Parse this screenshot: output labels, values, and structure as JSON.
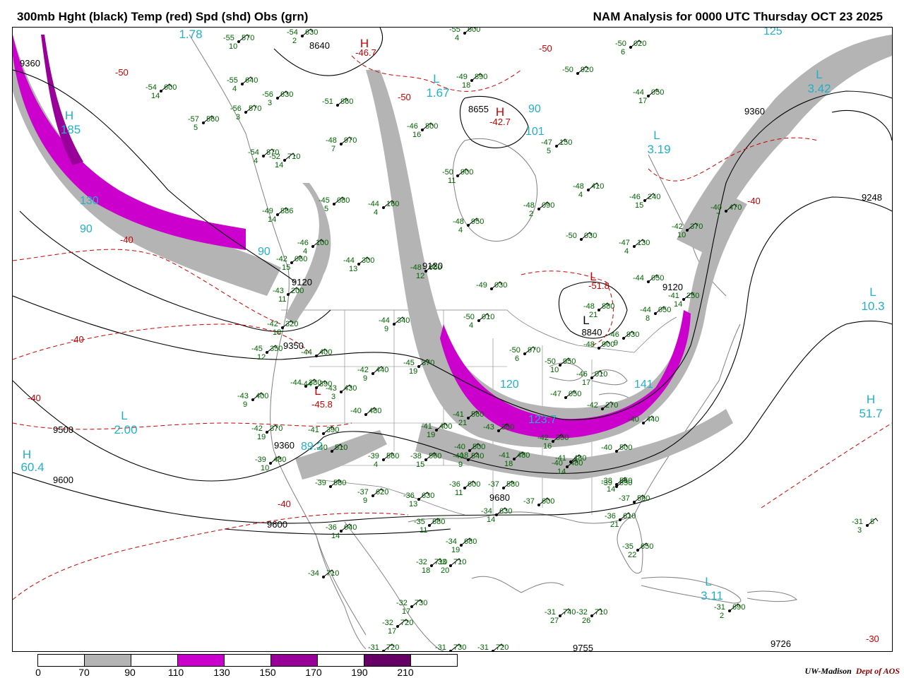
{
  "header": {
    "left_title": "300mb Hght (black) Temp (red) Spd (shd) Obs (grn)",
    "right_title": "NAM Analysis for 0000 UTC Thursday  OCT 23 2025"
  },
  "colors": {
    "height_contour": "#000000",
    "temperature_contour": "#cc0000",
    "observation_text": "#006400",
    "center_label": "#20b0c8",
    "speed_70_90": "#b4b4b4",
    "speed_110_130": "#cc00cc",
    "speed_150_170": "#990099",
    "speed_190_210": "#660066",
    "map_border": "#808080"
  },
  "legend": {
    "ticks": [
      "0",
      "70",
      "90",
      "110",
      "130",
      "150",
      "170",
      "190",
      "210"
    ],
    "swatch_colors": [
      "#ffffff",
      "#b4b4b4",
      "#ffffff",
      "#cc00cc",
      "#ffffff",
      "#990099",
      "#ffffff",
      "#660066",
      "#ffffff"
    ]
  },
  "credit": {
    "org": "UW-Madison",
    "dept": "Dept of AOS"
  },
  "pressure_centers": [
    {
      "letter": "H",
      "value": "60.4",
      "color": "#20b0c8"
    },
    {
      "letter": "L",
      "value": "2.00",
      "color": "#20b0c8"
    },
    {
      "letter": "L",
      "value": "3.42",
      "color": "#20b0c8"
    },
    {
      "letter": "L",
      "value": "3.19",
      "color": "#20b0c8"
    },
    {
      "letter": "L",
      "value": "10.3",
      "color": "#20b0c8"
    },
    {
      "letter": "H",
      "value": "51.7",
      "color": "#20b0c8"
    },
    {
      "letter": "L",
      "value": "3.11",
      "color": "#20b0c8"
    },
    {
      "letter": "H",
      "value": "185",
      "color": "#20b0c8"
    },
    {
      "letter": "L",
      "value": "1.78",
      "color": "#20b0c8"
    },
    {
      "letter": "L",
      "value": "1.67",
      "color": "#20b0c8"
    },
    {
      "letter": "H",
      "value": "-46.7",
      "color": "#cc0000"
    },
    {
      "letter": "H",
      "value": "-42.7",
      "color": "#cc0000"
    },
    {
      "letter": "L",
      "value": "-51.8",
      "color": "#cc0000"
    },
    {
      "letter": "L",
      "value": "-45.8",
      "color": "#cc0000"
    },
    {
      "letter": "L",
      "value": "8840",
      "color": "#000000"
    }
  ],
  "contour_labels": {
    "heights": [
      "9360",
      "8640",
      "8655",
      "9360",
      "9120",
      "9120",
      "9350",
      "9120",
      "9360",
      "9500",
      "9600",
      "9600",
      "9680",
      "9248",
      "9726",
      "9755"
    ],
    "temperatures": [
      "-50",
      "-50",
      "-50",
      "-40",
      "-40",
      "-40",
      "-40",
      "-40",
      "-30"
    ],
    "speeds": [
      "130",
      "90",
      "90",
      "90",
      "101",
      "120",
      "89.2",
      "123.7",
      "141",
      "125"
    ]
  },
  "observations": [
    {
      "t": "-55",
      "h": "570",
      "d": "10"
    },
    {
      "t": "-54",
      "h": "630",
      "d": "2"
    },
    {
      "t": "-55",
      "h": "600",
      "d": "4"
    },
    {
      "t": "-50",
      "h": "020",
      "d": "6"
    },
    {
      "t": "-54",
      "h": "600",
      "d": "14"
    },
    {
      "t": "-55",
      "h": "640",
      "d": "4"
    },
    {
      "t": "-56",
      "h": "630",
      "d": "3"
    },
    {
      "t": "-56",
      "h": "570",
      "d": "3"
    },
    {
      "t": "-57",
      "h": "560",
      "d": "5"
    },
    {
      "t": "-49",
      "h": "890",
      "d": "18"
    },
    {
      "t": "-51",
      "h": "860",
      "d": ""
    },
    {
      "t": "-50",
      "h": "920",
      "d": ""
    },
    {
      "t": "-44",
      "h": "050",
      "d": "17"
    },
    {
      "t": "-48",
      "h": "970",
      "d": "7"
    },
    {
      "t": "-46",
      "h": "800",
      "d": "16"
    },
    {
      "t": "-47",
      "h": "150",
      "d": "5"
    },
    {
      "t": "-54",
      "h": "870",
      "d": "4"
    },
    {
      "t": "-52",
      "h": "710",
      "d": "14"
    },
    {
      "t": "-50",
      "h": "900",
      "d": "11"
    },
    {
      "t": "-48",
      "h": "410",
      "d": "4"
    },
    {
      "t": "-46",
      "h": "240",
      "d": "15"
    },
    {
      "t": "-40",
      "h": "470",
      "d": "7"
    },
    {
      "t": "-49",
      "h": "886",
      "d": "14"
    },
    {
      "t": "-45",
      "h": "080",
      "d": "5"
    },
    {
      "t": "-44",
      "h": "160",
      "d": "4"
    },
    {
      "t": "-48",
      "h": "090",
      "d": "2"
    },
    {
      "t": "-48",
      "h": "950",
      "d": "4"
    },
    {
      "t": "-50",
      "h": "030",
      "d": ""
    },
    {
      "t": "-42",
      "h": "370",
      "d": "10"
    },
    {
      "t": "-46",
      "h": "100",
      "d": "4"
    },
    {
      "t": "-47",
      "h": "130",
      "d": "4"
    },
    {
      "t": "-42",
      "h": "060",
      "d": "15"
    },
    {
      "t": "-44",
      "h": "300",
      "d": "13"
    },
    {
      "t": "-48",
      "h": "060",
      "d": "12"
    },
    {
      "t": "-49",
      "h": "030",
      "d": ""
    },
    {
      "t": "-44",
      "h": "050",
      "d": ""
    },
    {
      "t": "-43",
      "h": "200",
      "d": "11"
    },
    {
      "t": "-41",
      "h": "250",
      "d": "14"
    },
    {
      "t": "-48",
      "h": "880",
      "d": "21"
    },
    {
      "t": "-44",
      "h": "050",
      "d": "8"
    },
    {
      "t": "-42",
      "h": "320",
      "d": "18"
    },
    {
      "t": "-44",
      "h": "340",
      "d": "9"
    },
    {
      "t": "-50",
      "h": "010",
      "d": "4"
    },
    {
      "t": "-46",
      "h": "930",
      "d": "9"
    },
    {
      "t": "-45",
      "h": "350",
      "d": "12"
    },
    {
      "t": "-44",
      "h": "400",
      "d": ""
    },
    {
      "t": "-45",
      "h": "370",
      "d": "19"
    },
    {
      "t": "-50",
      "h": "970",
      "d": "6"
    },
    {
      "t": "-50",
      "h": "950",
      "d": "10"
    },
    {
      "t": "-48",
      "h": "900",
      "d": ""
    },
    {
      "t": "-46",
      "h": "010",
      "d": "17"
    },
    {
      "t": "-42",
      "h": "440",
      "d": "9"
    },
    {
      "t": "-44",
      "h": "380",
      "d": ""
    },
    {
      "t": "-44",
      "h": "390",
      "d": ""
    },
    {
      "t": "-43",
      "h": "430",
      "d": "3"
    },
    {
      "t": "-43",
      "h": "400",
      "d": "9"
    },
    {
      "t": "-40",
      "h": "480",
      "d": ""
    },
    {
      "t": "-47",
      "h": "050",
      "d": ""
    },
    {
      "t": "-42",
      "h": "270",
      "d": ""
    },
    {
      "t": "-40",
      "h": "440",
      "d": ""
    },
    {
      "t": "-42",
      "h": "370",
      "d": "19"
    },
    {
      "t": "-41",
      "h": "400",
      "d": "19"
    },
    {
      "t": "-41",
      "h": "390",
      "d": ""
    },
    {
      "t": "-40",
      "h": "510",
      "d": ""
    },
    {
      "t": "-41",
      "h": "560",
      "d": "21"
    },
    {
      "t": "-43",
      "h": "350",
      "d": ""
    },
    {
      "t": "-40",
      "h": "500",
      "d": "18"
    },
    {
      "t": "-42",
      "h": "350",
      "d": "16"
    },
    {
      "t": "-40",
      "h": "500",
      "d": ""
    },
    {
      "t": "-39",
      "h": "480",
      "d": "10"
    },
    {
      "t": "-39",
      "h": "560",
      "d": "4"
    },
    {
      "t": "-38",
      "h": "560",
      "d": "15"
    },
    {
      "t": "-40",
      "h": "540",
      "d": "9"
    },
    {
      "t": "-41",
      "h": "480",
      "d": "18"
    },
    {
      "t": "-40",
      "h": "480",
      "d": "14"
    },
    {
      "t": "-41",
      "h": "480",
      "d": ""
    },
    {
      "t": "-38",
      "h": "550",
      "d": "14"
    },
    {
      "t": "-39",
      "h": "550",
      "d": ""
    },
    {
      "t": "-39",
      "h": "580",
      "d": ""
    },
    {
      "t": "-37",
      "h": "620",
      "d": "9"
    },
    {
      "t": "-36",
      "h": "630",
      "d": "13"
    },
    {
      "t": "-36",
      "h": "600",
      "d": "11"
    },
    {
      "t": "-37",
      "h": "580",
      "d": ""
    },
    {
      "t": "-37",
      "h": "590",
      "d": ""
    },
    {
      "t": "-37",
      "h": "600",
      "d": ""
    },
    {
      "t": "-36",
      "h": "610",
      "d": "21"
    },
    {
      "t": "-34",
      "h": "630",
      "d": "14"
    },
    {
      "t": "-36",
      "h": "640",
      "d": "14"
    },
    {
      "t": "-35",
      "h": "680",
      "d": "11"
    },
    {
      "t": "-34",
      "h": "680",
      "d": "19"
    },
    {
      "t": "-35",
      "h": "650",
      "d": "22"
    },
    {
      "t": "-32",
      "h": "710",
      "d": "18"
    },
    {
      "t": "-33",
      "h": "710",
      "d": "20"
    },
    {
      "t": "-34",
      "h": "710",
      "d": ""
    },
    {
      "t": "-32",
      "h": "730",
      "d": "17"
    },
    {
      "t": "-32",
      "h": "720",
      "d": "17"
    },
    {
      "t": "-31",
      "h": "720",
      "d": ""
    },
    {
      "t": "-31",
      "h": "730",
      "d": ""
    },
    {
      "t": "-31",
      "h": "720",
      "d": ""
    },
    {
      "t": "-31",
      "h": "740",
      "d": "27"
    },
    {
      "t": "-32",
      "h": "710",
      "d": "26"
    },
    {
      "t": "-31",
      "h": "690",
      "d": "2"
    },
    {
      "t": "-31",
      "h": "8",
      "d": "3"
    }
  ]
}
